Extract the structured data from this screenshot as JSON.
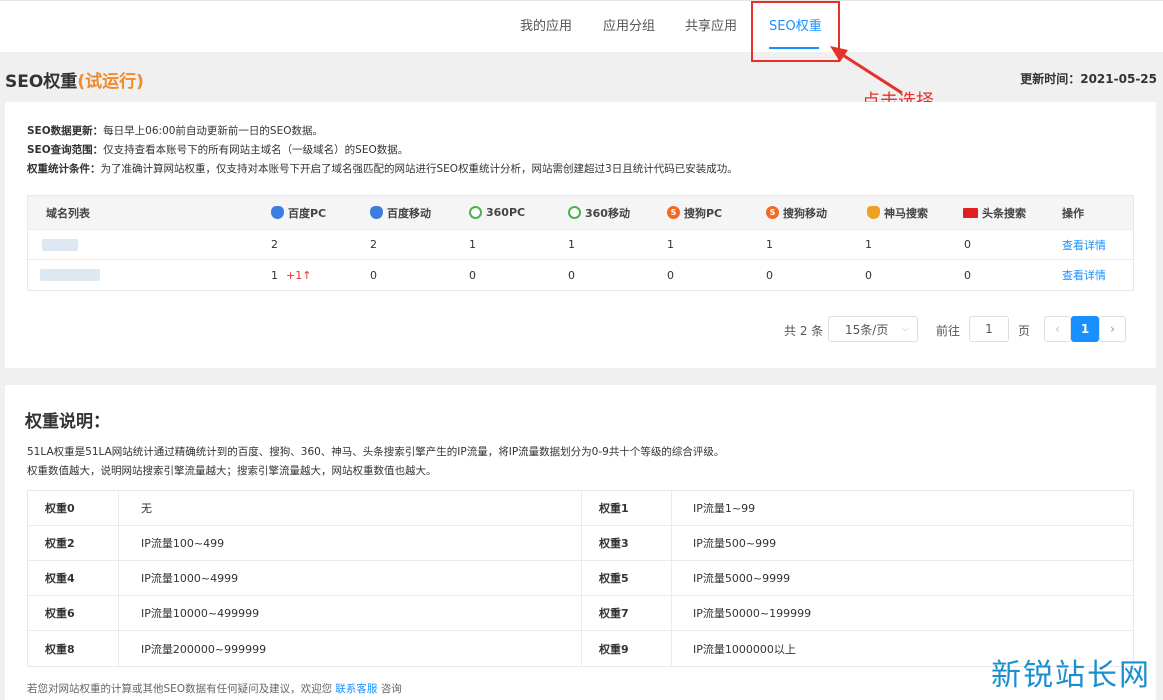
{
  "nav": {
    "tabs": [
      {
        "label": "我的应用"
      },
      {
        "label": "应用分组"
      },
      {
        "label": "共享应用"
      },
      {
        "label": "SEO权重"
      }
    ],
    "annotation": "点击选择"
  },
  "header": {
    "title": "SEO权重",
    "trial": "(试运行)",
    "update_label": "更新时间：",
    "update_date": "2021-05-25"
  },
  "desc": {
    "line1_label": "SEO数据更新：",
    "line1_text": "每日早上06:00前自动更新前一日的SEO数据。",
    "line2_label": "SEO查询范围：",
    "line2_text": "仅支持查看本账号下的所有网站主域名（一级域名）的SEO数据。",
    "line3_label": "权重统计条件：",
    "line3_text": "为了准确计算网站权重，仅支持对本账号下开启了域名强匹配的网站进行SEO权重统计分析，网站需创建超过3日且统计代码已安装成功。"
  },
  "seo_table": {
    "headers": {
      "domain": "域名列表",
      "baidu_pc": "百度PC",
      "baidu_mobile": "百度移动",
      "s360_pc": "360PC",
      "s360_mobile": "360移动",
      "sogou_pc": "搜狗PC",
      "sogou_mobile": "搜狗移动",
      "shenma": "神马搜索",
      "toutiao": "头条搜索",
      "action": "操作"
    },
    "rows": [
      {
        "baidu_pc": "2",
        "delta": "",
        "baidu_mobile": "2",
        "s360_pc": "1",
        "s360_mobile": "1",
        "sogou_pc": "1",
        "sogou_mobile": "1",
        "shenma": "1",
        "toutiao": "0",
        "action": "查看详情"
      },
      {
        "baidu_pc": "1",
        "delta": "+1↑",
        "baidu_mobile": "0",
        "s360_pc": "0",
        "s360_mobile": "0",
        "sogou_pc": "0",
        "sogou_mobile": "0",
        "shenma": "0",
        "toutiao": "0",
        "action": "查看详情"
      }
    ]
  },
  "pagination": {
    "total": "共 2 条",
    "page_size": "15条/页",
    "goto_label": "前往",
    "goto_value": "1",
    "page_unit": "页",
    "current": "1"
  },
  "weight": {
    "title": "权重说明：",
    "desc1": "51LA权重是51LA网站统计通过精确统计到的百度、搜狗、360、神马、头条搜索引擎产生的IP流量，将IP流量数据划分为0-9共十个等级的综合评级。",
    "desc2": "权重数值越大，说明网站搜索引擎流量越大；搜索引擎流量越大，网站权重数值也越大。",
    "rows": [
      {
        "l1": "权重0",
        "v1": "无",
        "l2": "权重1",
        "v2": "IP流量1~99"
      },
      {
        "l1": "权重2",
        "v1": "IP流量100~499",
        "l2": "权重3",
        "v2": "IP流量500~999"
      },
      {
        "l1": "权重4",
        "v1": "IP流量1000~4999",
        "l2": "权重5",
        "v2": "IP流量5000~9999"
      },
      {
        "l1": "权重6",
        "v1": "IP流量10000~499999",
        "l2": "权重7",
        "v2": "IP流量50000~199999"
      },
      {
        "l1": "权重8",
        "v1": "IP流量200000~999999",
        "l2": "权重9",
        "v2": "IP流量1000000以上"
      }
    ],
    "footer_prefix": "若您对网站权重的计算或其他SEO数据有任何疑问及建议，欢迎您",
    "footer_link": "联系客服",
    "footer_suffix": "咨询"
  },
  "watermark": "新锐站长网",
  "colors": {
    "accent": "#1890ff",
    "trial": "#f08a2a",
    "annotation": "#e6312a"
  }
}
